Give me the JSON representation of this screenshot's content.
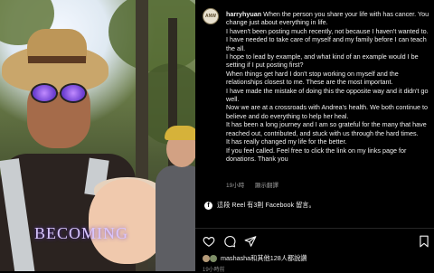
{
  "video": {
    "caption": "BECOMING"
  },
  "post": {
    "avatar_text": "ANW",
    "username": "harryhyuan",
    "paragraphs": [
      "When the person you share your life with has cancer. You change just about everything in life.",
      "I haven't been posting much recently, not because I haven't wanted to. I have needed to take care of myself and my family before I can teach the all.",
      "I hope to lead by example, and what kind of an example would I be setting if I put posting first?",
      "When things get hard I don't stop working on myself and the relationships closest to me. These are the most important.",
      "I have made the mistake of doing this the opposite way and it didn't go well.",
      "Now we are at a crossroads with Andrea's health. We both continue to believe and do everything to help her heal.",
      "It has been a long journey and I am so grateful for the many that have reached out, contributed, and stuck with us through the hard times.",
      "It has really changed my life for the better.",
      "If you feel called. Feel free to click the link on my links page for donations. Thank you"
    ],
    "time_ago": "19小時",
    "see_translation": "顯示翻譯",
    "reel_share": "這段 Reel 有3則 Facebook 留言。",
    "likes_text": "mashasha和其他128人都說讚",
    "footer_time": "19小時前"
  }
}
